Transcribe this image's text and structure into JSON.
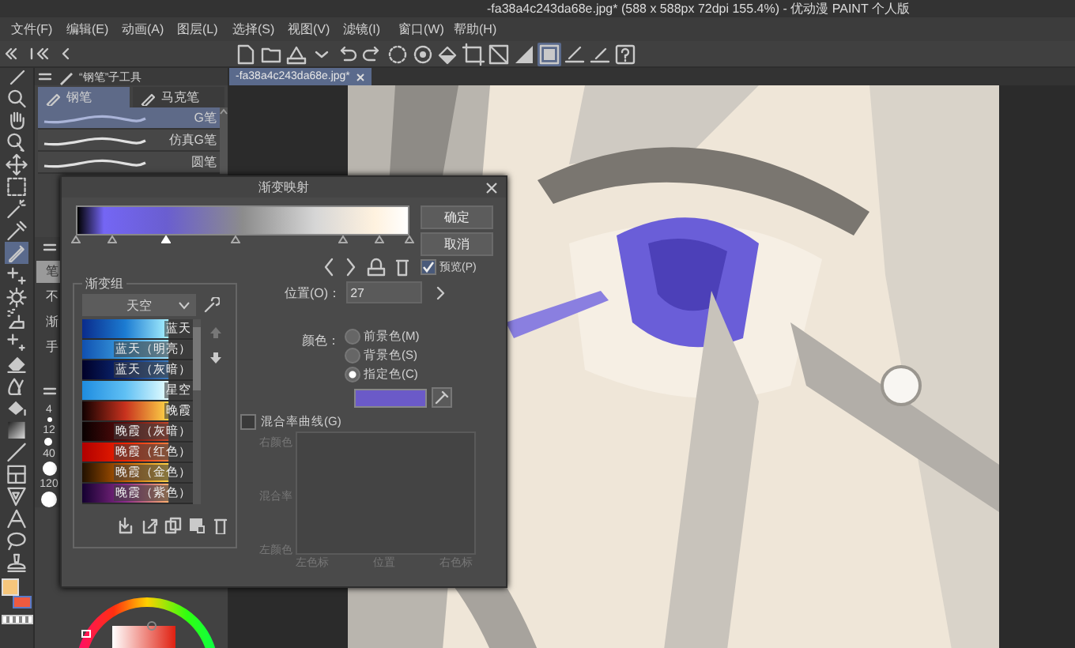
{
  "window": {
    "title": "-fa38a4c243da68e.jpg* (588 x 588px 72dpi 155.4%)  - 优动漫 PAINT 个人版"
  },
  "menu": [
    "文件(F)",
    "编辑(E)",
    "动画(A)",
    "图层(L)",
    "选择(S)",
    "视图(V)",
    "滤镜(I)",
    "窗口(W)",
    "帮助(H)"
  ],
  "tools": [
    {
      "selected": false
    },
    {
      "selected": false
    },
    {
      "selected": false
    },
    {
      "selected": false
    },
    {
      "selected": false
    },
    {
      "selected": false
    },
    {
      "selected": false
    },
    {
      "selected": true
    },
    {
      "selected": false
    },
    {
      "selected": false
    },
    {
      "selected": false
    },
    {
      "selected": false
    },
    {
      "selected": false
    },
    {
      "selected": false
    },
    {
      "selected": false
    },
    {
      "selected": false
    },
    {
      "selected": false
    },
    {
      "selected": false
    },
    {
      "selected": false
    },
    {
      "selected": false
    },
    {
      "selected": false
    },
    {
      "selected": false
    }
  ],
  "color_swatches": [
    {
      "kind": "foreground",
      "color": "#f6c67c"
    },
    {
      "kind": "background",
      "color": "#ee5a40"
    }
  ],
  "command_bar": [
    {
      "selected": false
    },
    {
      "selected": false
    },
    {
      "selected": false
    },
    {
      "selected": false
    },
    {
      "selected": false
    },
    {
      "selected": false
    },
    {
      "selected": false
    },
    {
      "selected": false
    },
    {
      "selected": false
    },
    {
      "selected": false
    },
    {
      "selected": false
    },
    {
      "selected": false
    },
    {
      "selected": true
    },
    {
      "selected": false
    },
    {
      "selected": false
    },
    {
      "selected": false
    }
  ],
  "sub_tool": {
    "title": "“钢笔”子工具",
    "tabs": [
      {
        "label": "钢笔",
        "selected": true
      },
      {
        "label": "马克笔",
        "selected": false
      }
    ],
    "brushes": [
      {
        "name": "G笔",
        "selected": true
      },
      {
        "name": "仿真G笔",
        "selected": false
      },
      {
        "name": "圆笔",
        "selected": false
      }
    ]
  },
  "side_list": [
    {
      "label": "笔",
      "selected": true
    },
    {
      "label": "不",
      "selected": false
    },
    {
      "label": "渐",
      "selected": false
    },
    {
      "label": "手",
      "selected": false
    }
  ],
  "brush_sizes": [
    "4",
    "12",
    "40",
    "120"
  ],
  "document_tab": {
    "title": "-fa38a4c243da68e.jpg*"
  },
  "dialog": {
    "title": "渐变映射",
    "gradient": {
      "stops": [
        {
          "selected": false
        },
        {
          "selected": false
        },
        {
          "selected": true
        },
        {
          "selected": false
        },
        {
          "selected": false
        },
        {
          "selected": false
        },
        {
          "selected": false
        }
      ]
    },
    "buttons": [
      "确定",
      "取消"
    ],
    "preview": {
      "label": "预览(P)",
      "checked": true
    },
    "position": {
      "label": "位置(O)：",
      "value": "27"
    },
    "gradient_set": {
      "label": "渐变组",
      "dropdown": "天空",
      "items": [
        {
          "name": "蓝天"
        },
        {
          "name": "蓝天（明亮）"
        },
        {
          "name": "蓝天（灰暗）"
        },
        {
          "name": "星空"
        },
        {
          "name": "晚霞"
        },
        {
          "name": "晚霞（灰暗）"
        },
        {
          "name": "晚霞（红色）"
        },
        {
          "name": "晚霞（金色）"
        },
        {
          "name": "晚霞（紫色）"
        }
      ]
    },
    "color": {
      "label": "颜色：",
      "options": [
        {
          "label": "前景色(M)",
          "selected": false
        },
        {
          "label": "背景色(S)",
          "selected": false
        },
        {
          "label": "指定色(C)",
          "selected": true
        }
      ],
      "specified": {
        "color": "#6b5ac8"
      }
    },
    "curve": {
      "label": "混合率曲线(G)",
      "checked": false,
      "right_label": "右颜色",
      "mid_label": "混合率",
      "left_label": "左颜色",
      "x_labels": [
        "左色标",
        "位置",
        "右色标"
      ]
    }
  }
}
